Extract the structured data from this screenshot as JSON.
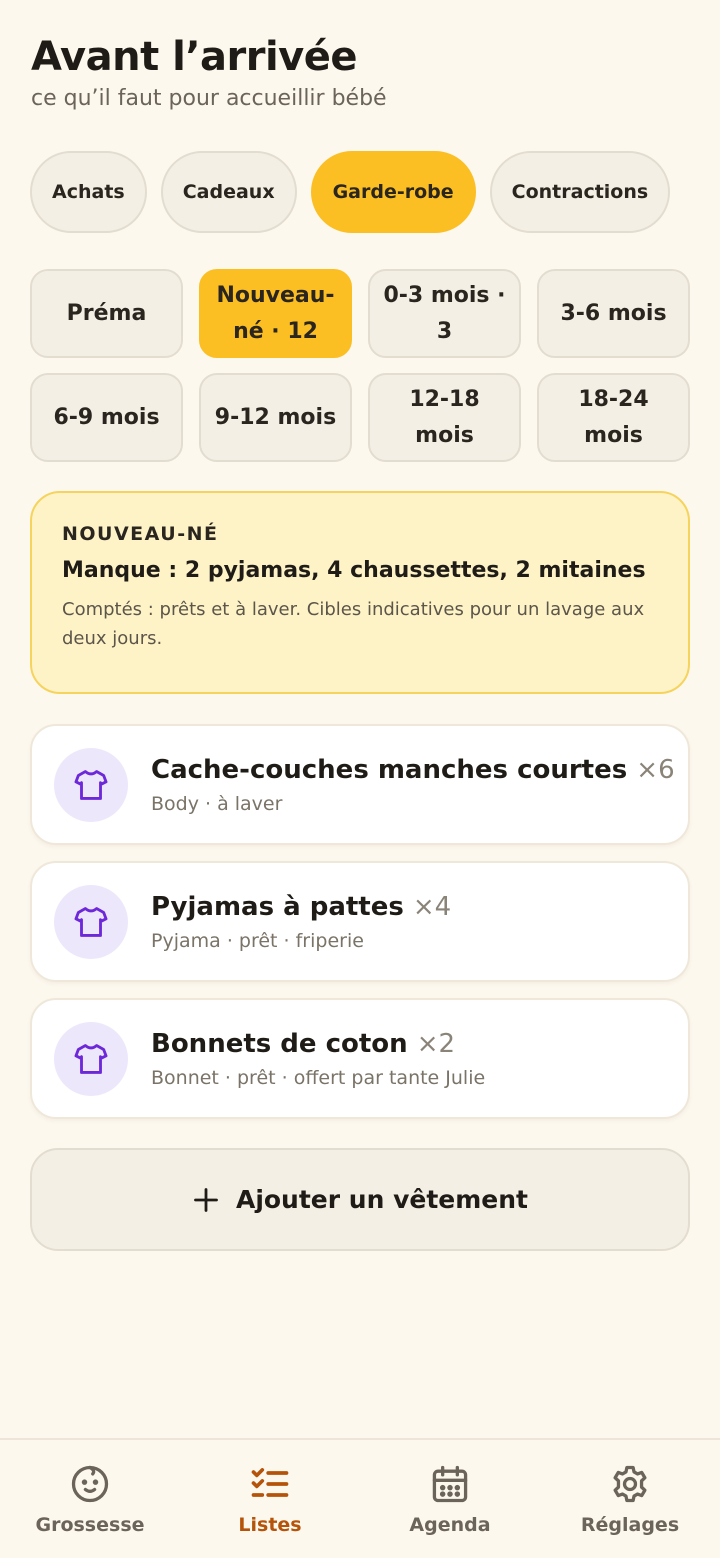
{
  "header": {
    "title": "Avant l’arrivée",
    "subtitle": "ce qu’il faut pour accueillir bébé"
  },
  "tabs": [
    {
      "label": "Achats",
      "active": false
    },
    {
      "label": "Cadeaux",
      "active": false
    },
    {
      "label": "Garde-robe",
      "active": true
    },
    {
      "label": "Contractions",
      "active": false
    }
  ],
  "sizes": [
    {
      "label": "Préma",
      "active": false
    },
    {
      "label": "Nouveau-né · 12",
      "active": true
    },
    {
      "label": "0-3 mois · 3",
      "active": false
    },
    {
      "label": "3-6 mois",
      "active": false
    },
    {
      "label": "6-9 mois",
      "active": false
    },
    {
      "label": "9-12 mois",
      "active": false
    },
    {
      "label": "12-18 mois",
      "active": false
    },
    {
      "label": "18-24 mois",
      "active": false
    }
  ],
  "summary": {
    "eyebrow": "NOUVEAU-NÉ",
    "missing": "Manque : 2 pyjamas, 4 chaussettes, 2 mitaines",
    "note": "Comptés : prêts et à laver. Cibles indicatives pour un lavage aux deux jours."
  },
  "items": [
    {
      "name": "Cache-couches manches courtes",
      "qty": "×6",
      "meta": "Body · à laver",
      "icon": "shirt-icon"
    },
    {
      "name": "Pyjamas à pattes",
      "qty": "×4",
      "meta": "Pyjama · prêt · friperie",
      "icon": "shirt-icon"
    },
    {
      "name": "Bonnets de coton",
      "qty": "×2",
      "meta": "Bonnet · prêt · offert par tante Julie",
      "icon": "shirt-icon"
    }
  ],
  "add_button": {
    "label": "Ajouter un vêtement",
    "icon": "plus-icon"
  },
  "nav": [
    {
      "label": "Grossesse",
      "icon": "baby-icon",
      "active": false
    },
    {
      "label": "Listes",
      "icon": "checklist-icon",
      "active": true
    },
    {
      "label": "Agenda",
      "icon": "calendar-icon",
      "active": false
    },
    {
      "label": "Réglages",
      "icon": "gear-icon",
      "active": false
    }
  ],
  "colors": {
    "accent": "#FBBF24",
    "active_nav": "#B45309",
    "icon_purple": "#6D28D9",
    "background": "#FDF8EE"
  }
}
